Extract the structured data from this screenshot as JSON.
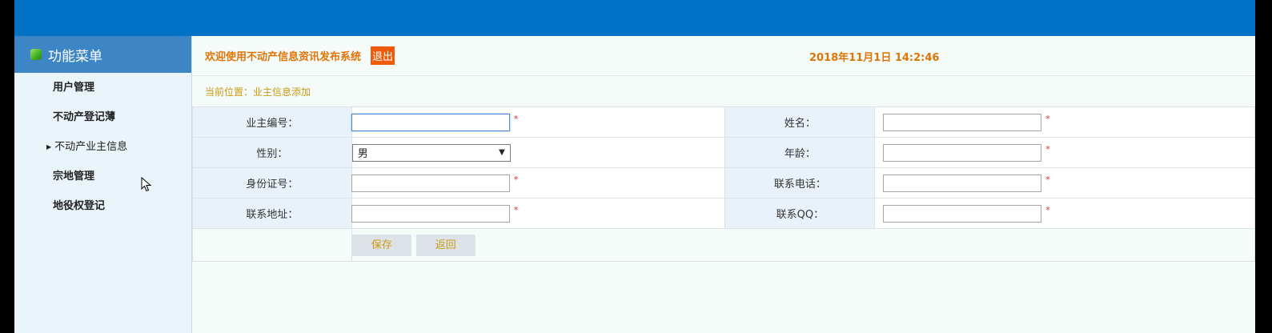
{
  "sidebar": {
    "title": "功能菜单",
    "items": [
      {
        "label": "用户管理"
      },
      {
        "label": "不动产登记薄"
      },
      {
        "label": "不动产业主信息",
        "active": true
      },
      {
        "label": "宗地管理"
      },
      {
        "label": "地役权登记"
      }
    ]
  },
  "header": {
    "welcome": "欢迎使用不动产信息资讯发布系统",
    "logout": "退出",
    "datetime": "2018年11月1日 14:2:46"
  },
  "breadcrumb": "当前位置：业主信息添加",
  "form": {
    "owner_id_label": "业主编号：",
    "name_label": "姓名：",
    "gender_label": "性别：",
    "gender_value": "男",
    "age_label": "年龄：",
    "id_card_label": "身份证号：",
    "phone_label": "联系电话：",
    "address_label": "联系地址：",
    "qq_label": "联系QQ：",
    "required_mark": "*",
    "save": "保存",
    "back": "返回"
  },
  "colors": {
    "topbar": "#0272c7",
    "menu_header": "#3d86c6",
    "accent_orange": "#e07406",
    "logout_bg": "#ef5b09",
    "breadcrumb": "#c99a12"
  }
}
